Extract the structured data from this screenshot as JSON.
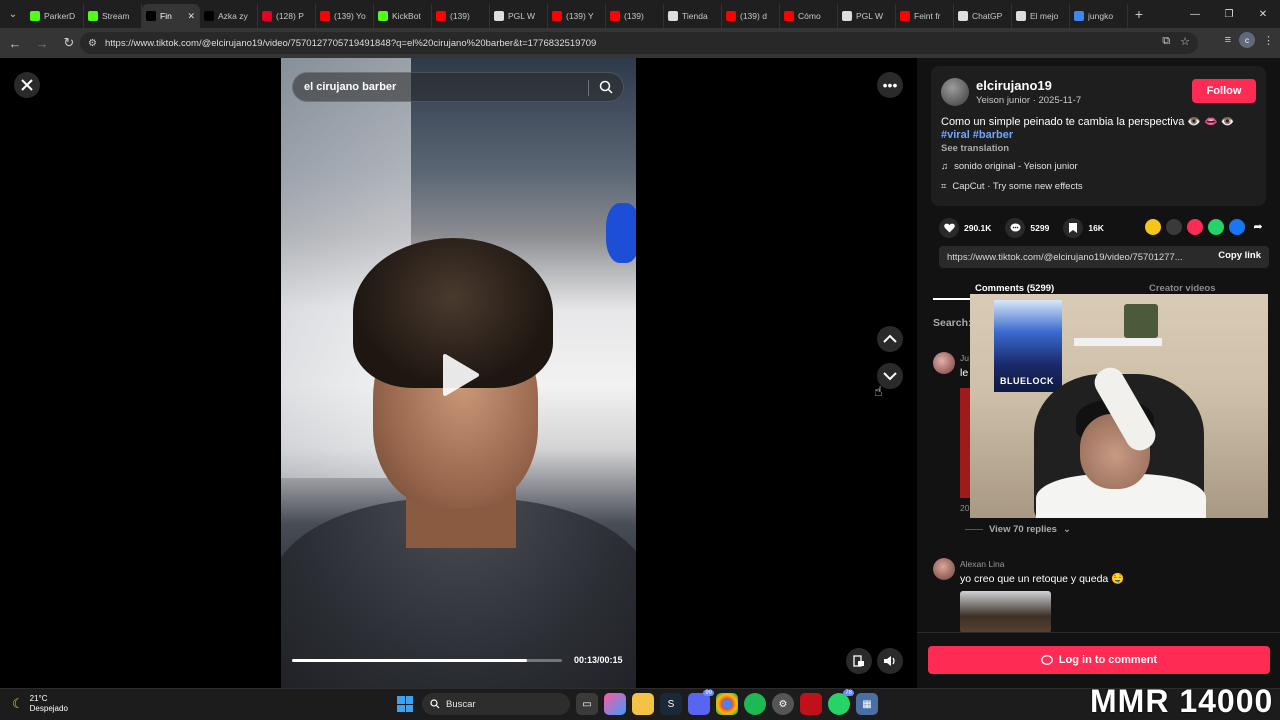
{
  "browser": {
    "tabs": [
      {
        "label": "ParkerD",
        "color": "#53fc18",
        "active": false
      },
      {
        "label": "Stream",
        "color": "#53fc18",
        "active": false
      },
      {
        "label": "Fin",
        "color": "#000000",
        "active": true
      },
      {
        "label": "Azka zy",
        "color": "#000000",
        "active": false
      },
      {
        "label": "(128) P",
        "color": "#e60023",
        "active": false
      },
      {
        "label": "(139) Yo",
        "color": "#ff0000",
        "active": false
      },
      {
        "label": "KickBot",
        "color": "#53fc18",
        "active": false
      },
      {
        "label": "(139)",
        "color": "#ff0000",
        "active": false
      },
      {
        "label": "PGL W",
        "color": "#dddddd",
        "active": false
      },
      {
        "label": "(139) Y",
        "color": "#ff0000",
        "active": false
      },
      {
        "label": "(139)",
        "color": "#ff0000",
        "active": false
      },
      {
        "label": "Tienda",
        "color": "#dddddd",
        "active": false
      },
      {
        "label": "(139) d",
        "color": "#ff0000",
        "active": false
      },
      {
        "label": "Cómo",
        "color": "#ff0000",
        "active": false
      },
      {
        "label": "PGL W",
        "color": "#dddddd",
        "active": false
      },
      {
        "label": "Feint fr",
        "color": "#ff0000",
        "active": false
      },
      {
        "label": "ChatGP",
        "color": "#dddddd",
        "active": false
      },
      {
        "label": "El mejo",
        "color": "#dddddd",
        "active": false
      },
      {
        "label": "jungko",
        "color": "#4285f4",
        "active": false
      }
    ],
    "url": "https://www.tiktok.com/@elcirujano19/video/7570127705719491848?q=el%20cirujano%20barber&t=1776832519709",
    "profile_initial": "c"
  },
  "video": {
    "search_text": "el cirujano barber",
    "time": "00:13/00:15",
    "progress": 0.87
  },
  "post": {
    "author": "elcirujano19",
    "meta": "Yeison junior · 2025-11-7",
    "follow_label": "Follow",
    "description": "Como un simple peinado te cambia la perspectiva 👁️ 👄 👁️",
    "hashtags": "#viral #barber",
    "see_translation": "See translation",
    "music": "sonido original - Yeison junior",
    "effect": "CapCut · Try some new effects",
    "likes": "290.1K",
    "comments_count": "5299",
    "saves": "16K",
    "link": "https://www.tiktok.com/@elcirujano19/video/75701277...",
    "copy_link": "Copy link",
    "tab_comments": "Comments (5299)",
    "tab_creator": "Creator videos",
    "search_label": "Search:",
    "comment1": {
      "name": "Ju",
      "text": "le",
      "date": "20"
    },
    "view_replies": "View 70 replies",
    "comment2": {
      "name": "Alexan Lina",
      "text": "yo creo que un retoque y queda 🤤"
    },
    "login_comment": "Log in to comment"
  },
  "webcam": {
    "poster_text": "BLUELOCK"
  },
  "taskbar": {
    "temp": "21°C",
    "weather": "Despejado",
    "search": "Buscar",
    "overlay_text": "MMR 14000"
  },
  "colors": {
    "accent": "#fe2c55",
    "hashtag": "#6fa8ff"
  }
}
